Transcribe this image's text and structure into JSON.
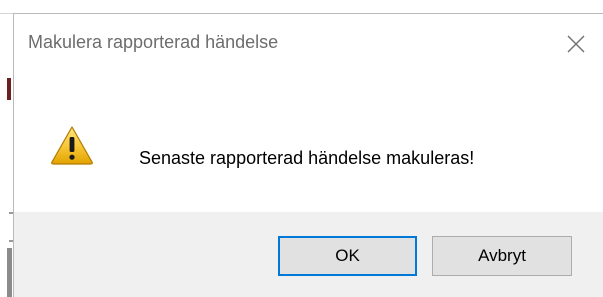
{
  "dialog": {
    "title": "Makulera rapporterad händelse",
    "message": "Senaste rapporterad händelse makuleras!",
    "icon": "warning-icon",
    "buttons": {
      "ok_label": "OK",
      "cancel_label": "Avbryt"
    }
  },
  "colors": {
    "focus_border": "#0078d7",
    "footer_bg": "#f0f0f0",
    "button_bg": "#e1e1e1",
    "warning_fill": "#f4c430"
  }
}
